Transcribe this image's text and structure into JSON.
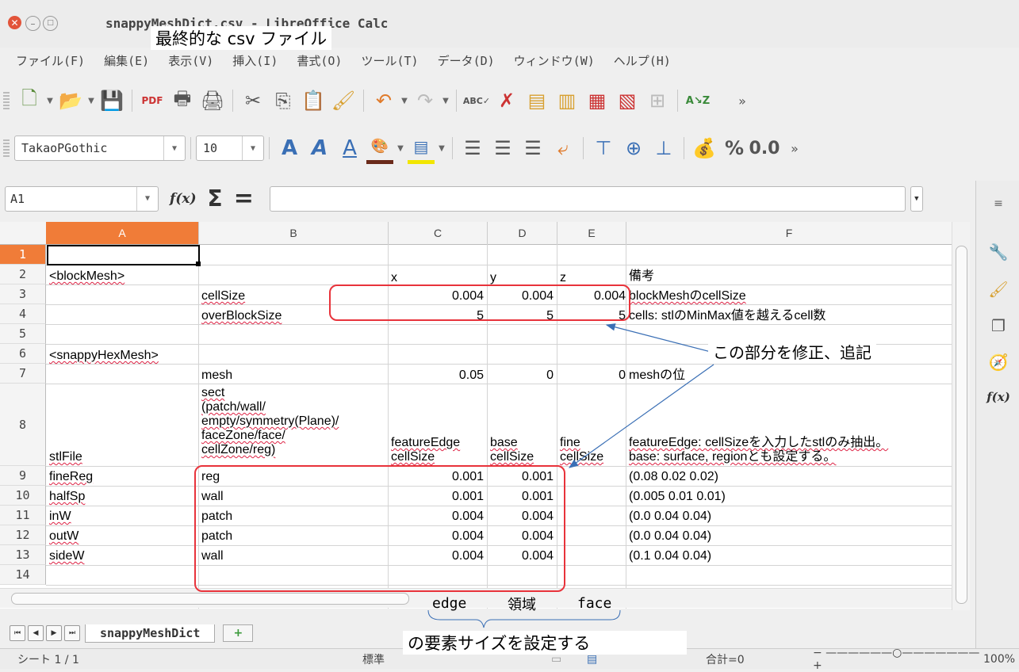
{
  "window": {
    "title": "snappyMeshDict.csv - LibreOffice Calc",
    "title_callout": "最終的な csv ファイル"
  },
  "menu": [
    "ファイル(F)",
    "編集(E)",
    "表示(V)",
    "挿入(I)",
    "書式(O)",
    "ツール(T)",
    "データ(D)",
    "ウィンドウ(W)",
    "ヘルプ(H)"
  ],
  "toolbar": {
    "font_name": "TakaoPGothic",
    "font_size": "10",
    "number_format_label": "0.0",
    "percent_label": "%"
  },
  "formula_bar": {
    "name_box": "A1",
    "fx_label": "f(x)",
    "sum_label": "Σ",
    "equals_label": "=",
    "content": ""
  },
  "columns": [
    "A",
    "B",
    "C",
    "D",
    "E",
    "F"
  ],
  "rows": [
    "1",
    "2",
    "3",
    "4",
    "5",
    "6",
    "7",
    "8",
    "9",
    "10",
    "11",
    "12",
    "13",
    "14"
  ],
  "cells": {
    "A2": "<blockMesh>",
    "C2": "x",
    "D2": "y",
    "E2": "z",
    "F2": "備考",
    "B3": "cellSize",
    "C3": "0.004",
    "D3": "0.004",
    "E3": "0.004",
    "F3": "blockMeshのcellSize",
    "B4": "overBlockSize",
    "C4": "5",
    "D4": "5",
    "E4": "5",
    "F4": "cells: stlのMinMax値を越えるcell数",
    "A6": "<snappyHexMesh>",
    "B7": "mesh",
    "C7": "0.05",
    "D7": "0",
    "E7": "0",
    "F7": "meshの位",
    "A8": "stlFile",
    "B8": "sect\n(patch/wall/\nempty/symmetry(Plane)/\nfaceZone/face/\ncellZone/reg)",
    "C8": "featureEdge\ncellSize",
    "D8": "base\ncellSize",
    "E8": "fine\ncellSize",
    "F8": "featureEdge: cellSizeを入力したstlのみ抽出。\nbase: surface, regionとも設定する。",
    "A9": "fineReg",
    "B9": "reg",
    "C9": "0.001",
    "D9": "0.001",
    "F9": "(0.08 0.02 0.02)",
    "A10": "halfSp",
    "B10": "wall",
    "C10": "0.001",
    "D10": "0.001",
    "F10": "(0.005 0.01 0.01)",
    "A11": "inW",
    "B11": "patch",
    "C11": "0.004",
    "D11": "0.004",
    "F11": "(0.0 0.04 0.04)",
    "A12": "outW",
    "B12": "patch",
    "C12": "0.004",
    "D12": "0.004",
    "F12": "(0.0 0.04 0.04)",
    "A13": "sideW",
    "B13": "wall",
    "C13": "0.004",
    "D13": "0.004",
    "F13": "(0.1 0.04 0.04)"
  },
  "annotations": {
    "modify_note": "この部分を修正、追記",
    "col_edge": "edge",
    "col_region": "領域",
    "col_face": "face",
    "size_note": "の要素サイズを設定する"
  },
  "sheet_tab": "snappyMeshDict",
  "status": {
    "sheet": "シート 1 / 1",
    "style": "標準",
    "sum": "合計=0",
    "zoom": "100%"
  },
  "colors": {
    "selected_header": "#f07c38",
    "annotation_red": "#e8333b",
    "arrow_blue": "#3a6fb5"
  }
}
